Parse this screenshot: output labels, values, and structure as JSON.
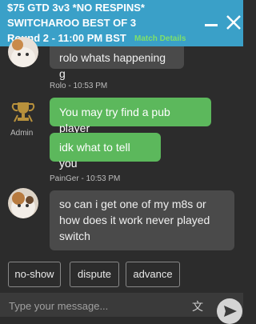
{
  "header": {
    "line1": "$75 GTD 3v3 *NO RESPINS*",
    "line2": "SWITCHAROO BEST OF 3",
    "line3": "Round 2 - 11:00 PM BST",
    "match_details": "Match Details",
    "icons": {
      "minimize": "minimize-icon",
      "close": "close-icon"
    }
  },
  "messages": [
    {
      "text": "rolo whats happening g"
    },
    {
      "author_time": "Rolo - 10:53 PM",
      "role": "Admin",
      "text": "You may try find a pub player"
    },
    {
      "text": "idk what to tell you"
    },
    {
      "author_time": "PainGer - 10:53 PM",
      "lines": [
        "so can i get one of my m8s or",
        "how does it work never played",
        "switch"
      ]
    }
  ],
  "actions": {
    "noshow": "no-show",
    "dispute": "dispute",
    "advance": "advance"
  },
  "composer": {
    "placeholder": "Type your message...",
    "translate_glyph": "文",
    "icons": {
      "translate": "translate-icon",
      "send": "send-icon"
    }
  },
  "colors": {
    "header": "#3aa0c8",
    "match_details": "#7ee06a",
    "bubble_green": "#5cb85c",
    "bubble_dark": "#4a4a4a",
    "background": "#2c2c2c"
  }
}
